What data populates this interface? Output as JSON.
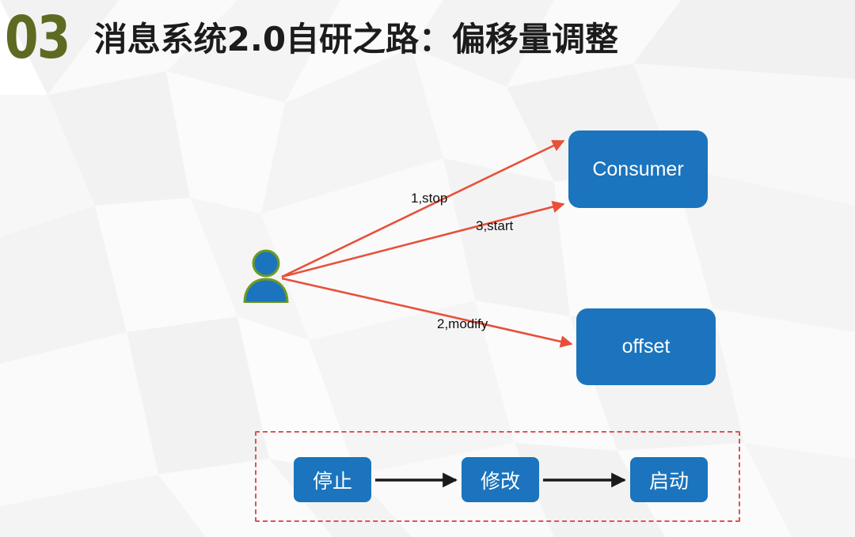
{
  "header": {
    "section_number": "03",
    "title": "消息系统2.0自研之路：偏移量调整",
    "number_color": "#5d6b22",
    "title_color": "#1c1c1c"
  },
  "diagram": {
    "actor": {
      "icon": "person-icon",
      "body_color": "#1b74bd",
      "outline_color": "#6f9b1e"
    },
    "nodes": [
      {
        "id": "consumer",
        "label": "Consumer",
        "color": "#1b74bd",
        "text_color": "#ffffff"
      },
      {
        "id": "offset",
        "label": "offset",
        "color": "#1b74bd",
        "text_color": "#ffffff"
      }
    ],
    "edges": [
      {
        "id": "stop",
        "label": "1,stop",
        "from": "actor",
        "to": "consumer",
        "color": "#e8503a"
      },
      {
        "id": "start",
        "label": "3,start",
        "from": "actor",
        "to": "consumer",
        "color": "#e8503a"
      },
      {
        "id": "modify",
        "label": "2,modify",
        "from": "actor",
        "to": "offset",
        "color": "#e8503a"
      }
    ]
  },
  "flow": {
    "border_color": "#e05252",
    "arrow_color": "#1a1a1a",
    "steps": [
      {
        "label": "停止",
        "color": "#1b74bd"
      },
      {
        "label": "修改",
        "color": "#1b74bd"
      },
      {
        "label": "启动",
        "color": "#1b74bd"
      }
    ]
  }
}
